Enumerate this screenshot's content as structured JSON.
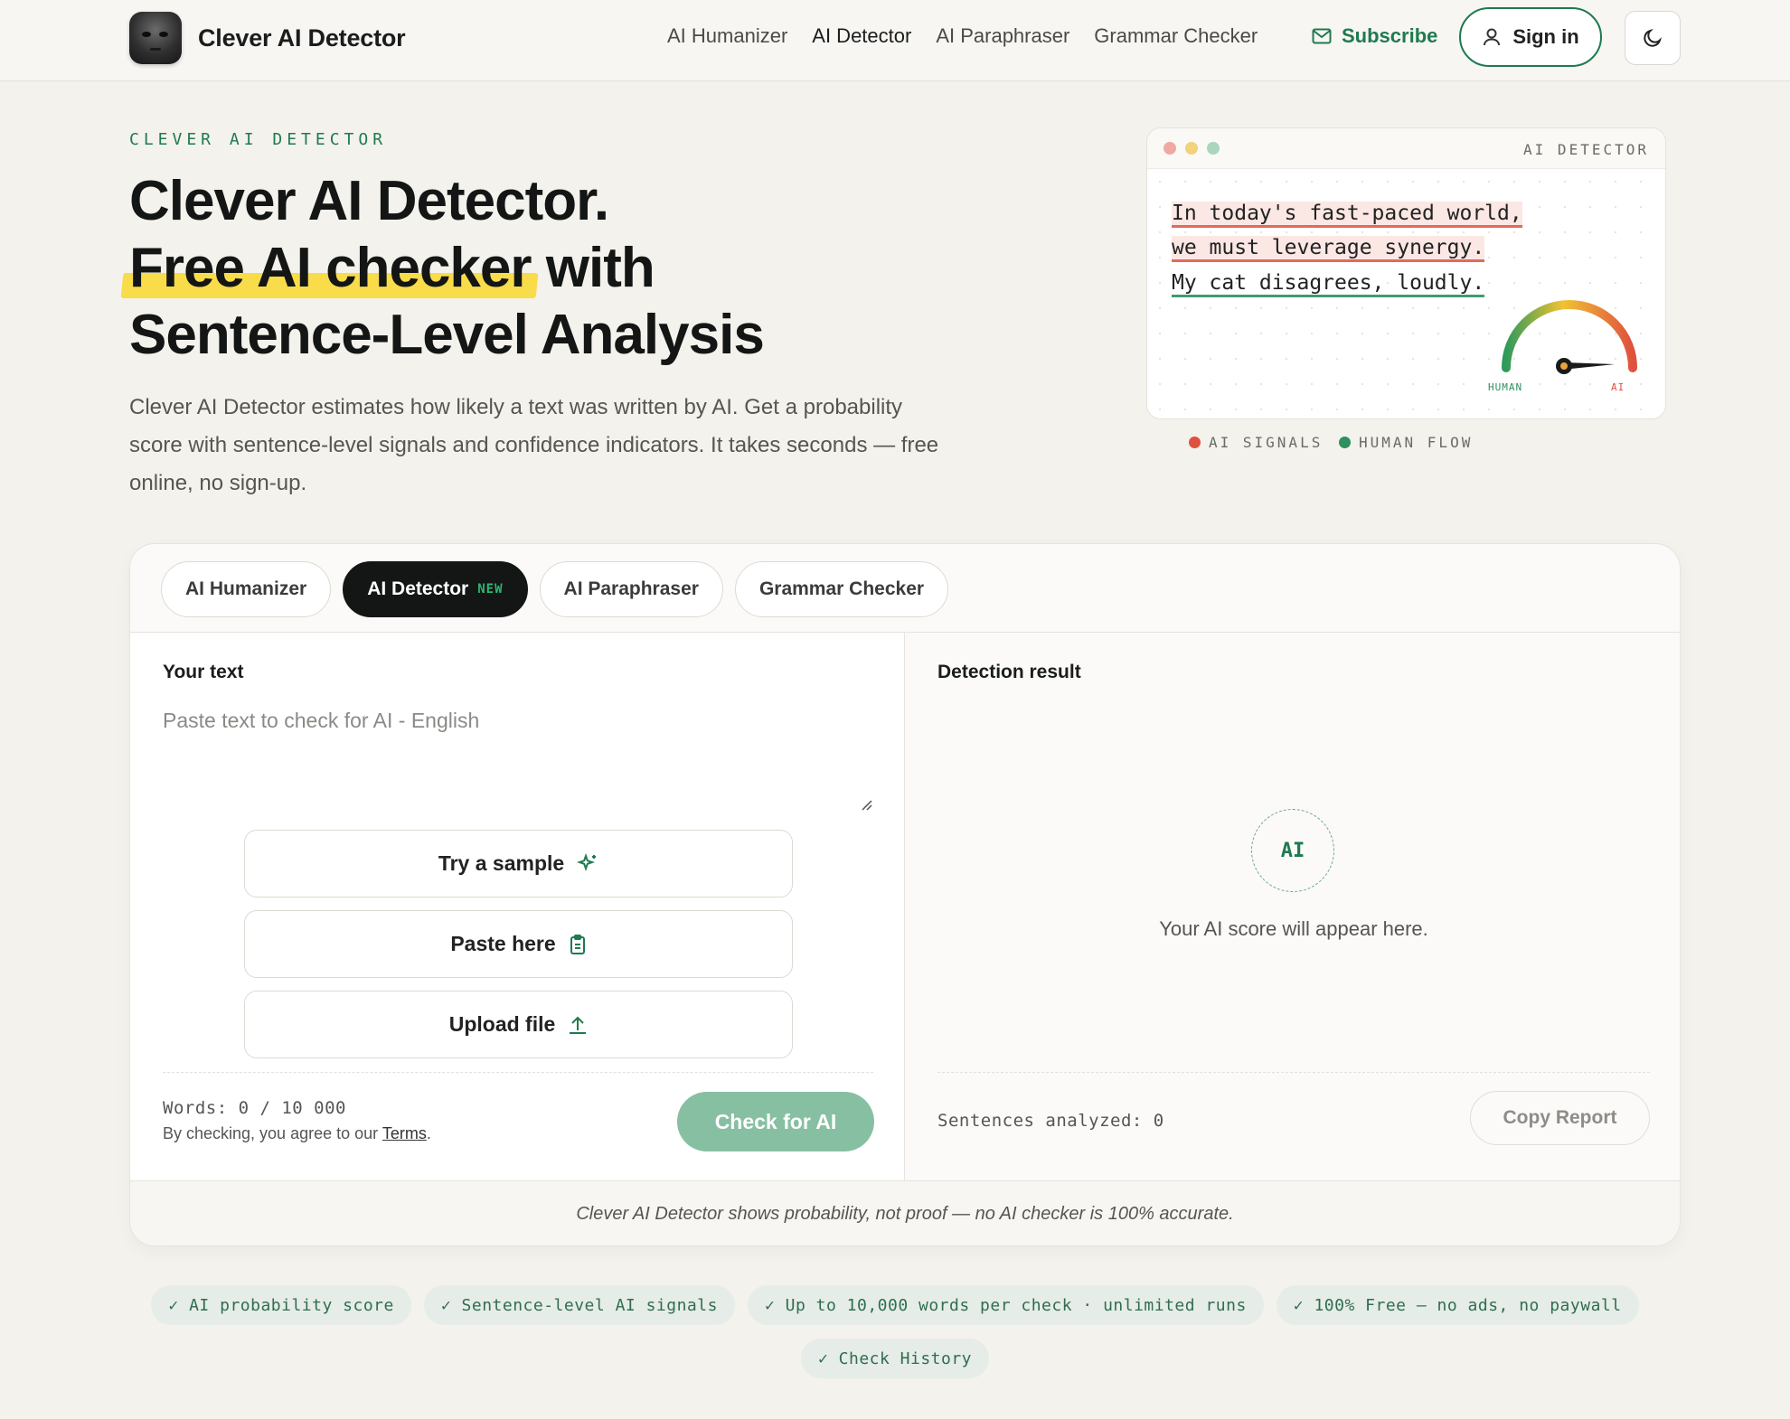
{
  "nav": {
    "brand": "Clever AI Detector",
    "links": [
      "AI Humanizer",
      "AI Detector",
      "AI Paraphraser",
      "Grammar Checker"
    ],
    "subscribe": "Subscribe",
    "signin": "Sign in"
  },
  "hero": {
    "eyebrow": "CLEVER AI DETECTOR",
    "title_line1": "Clever AI Detector.",
    "title_highlight": "Free AI checker",
    "title_line2_rest": " with",
    "title_line3": "Sentence-Level Analysis",
    "description": "Clever AI Detector estimates how likely a text was written by AI. Get a probability score with sentence-level signals and confidence indicators. It takes seconds — free online, no sign-up."
  },
  "preview": {
    "title": "AI DETECTOR",
    "lines": [
      "In today's fast-paced world,",
      "we must leverage synergy.",
      "My cat disagrees, loudly."
    ],
    "gauge_human": "HUMAN",
    "gauge_ai": "AI",
    "legend_ai": "AI SIGNALS",
    "legend_human": "HUMAN FLOW"
  },
  "tool": {
    "tabs": [
      "AI Humanizer",
      "AI Detector",
      "AI Paraphraser",
      "Grammar Checker"
    ],
    "new_badge": "NEW",
    "input_title": "Your text",
    "placeholder": "Paste text to check for AI - English",
    "try_sample": "Try a sample",
    "paste_here": "Paste here",
    "upload_file": "Upload file",
    "word_count": "Words: 0 / 10 000",
    "terms_prefix": "By checking, you agree to our ",
    "terms_link": "Terms",
    "terms_suffix": ".",
    "check_button": "Check for AI",
    "result_title": "Detection result",
    "ai_badge": "AI",
    "empty_message": "Your AI score will appear here.",
    "sentences": "Sentences analyzed: 0",
    "copy_report": "Copy Report",
    "disclaimer": "Clever AI Detector shows probability, not proof — no AI checker is 100% accurate."
  },
  "features": [
    "✓ AI probability score",
    "✓ Sentence-level AI signals",
    "✓ Up to 10,000 words per check · unlimited runs",
    "✓ 100% Free — no ads, no paywall",
    "✓ Check History"
  ],
  "colors": {
    "accent": "#1f7a4f",
    "highlight": "#f8dc4a",
    "ai_signal": "#e0503f",
    "human_flow": "#2f8f5e"
  }
}
